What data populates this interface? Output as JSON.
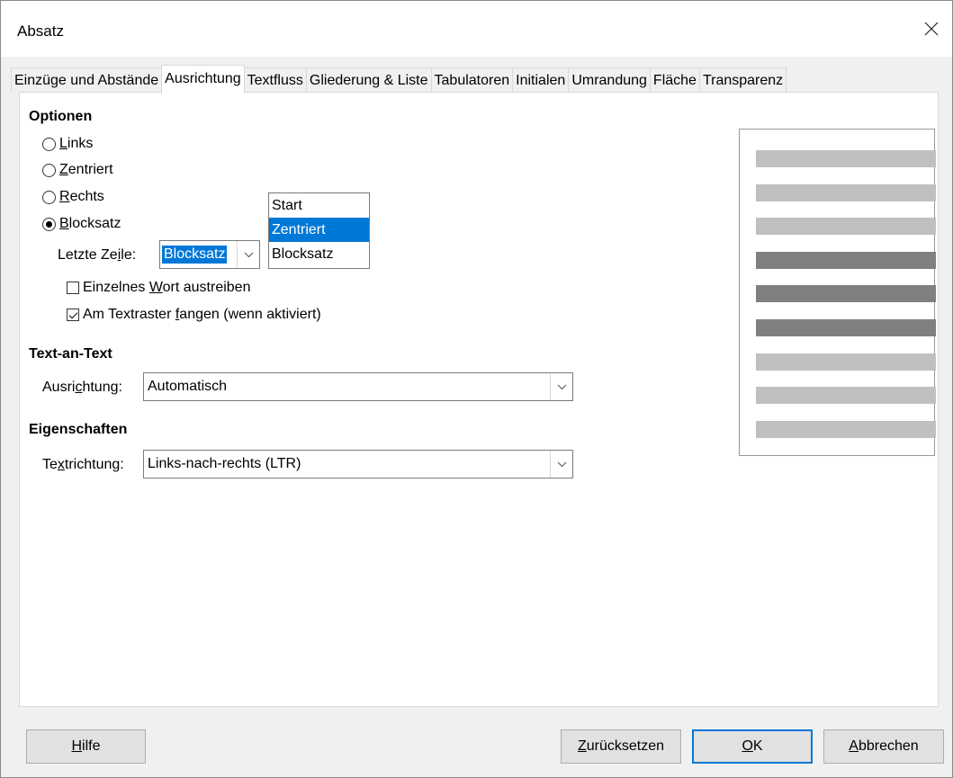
{
  "window": {
    "title": "Absatz"
  },
  "tabs": [
    {
      "label": "Einzüge und Abstände",
      "active": false
    },
    {
      "label": "Ausrichtung",
      "active": true
    },
    {
      "label": "Textfluss",
      "active": false
    },
    {
      "label": "Gliederung & Liste",
      "active": false
    },
    {
      "label": "Tabulatoren",
      "active": false
    },
    {
      "label": "Initialen",
      "active": false
    },
    {
      "label": "Umrandung",
      "active": false
    },
    {
      "label": "Fläche",
      "active": false
    },
    {
      "label": "Transparenz",
      "active": false
    }
  ],
  "options": {
    "heading": "Optionen",
    "radios": [
      {
        "accel": "L",
        "rest": "inks",
        "checked": false
      },
      {
        "accel": "Z",
        "rest": "entriert",
        "checked": false
      },
      {
        "accel": "R",
        "rest": "echts",
        "checked": false
      },
      {
        "accel": "B",
        "rest": "locksatz",
        "checked": true
      }
    ],
    "last_line": {
      "label_pre": "Letzte Ze",
      "label_accel": "i",
      "label_post": "le:",
      "value": "Blocksatz",
      "dropdown_options": [
        "Start",
        "Zentriert",
        "Blocksatz"
      ],
      "highlighted": "Zentriert"
    },
    "expand_word": {
      "pre": "Einzelnes ",
      "accel": "W",
      "post": "ort austreiben",
      "checked": false
    },
    "snap_grid": {
      "pre": "Am Textraster ",
      "accel": "f",
      "post": "angen (wenn aktiviert)",
      "checked": true
    }
  },
  "text_to_text": {
    "heading": "Text-an-Text",
    "label_pre": "Ausri",
    "label_accel": "c",
    "label_post": "htung:",
    "value": "Automatisch"
  },
  "properties": {
    "heading": "Eigenschaften",
    "label_pre": "Te",
    "label_accel": "x",
    "label_post": "trichtung:",
    "value": "Links-nach-rechts (LTR)"
  },
  "preview": {
    "colors": {
      "light": "#c0c0c0",
      "dark": "#808080"
    },
    "lines": [
      "light",
      "light",
      "light",
      "dark",
      "dark",
      "dark",
      "light",
      "light",
      "light"
    ]
  },
  "buttons": {
    "help": {
      "accel": "H",
      "rest": "ilfe"
    },
    "reset": {
      "accel": "Z",
      "rest": "urücksetzen"
    },
    "ok": {
      "accel": "O",
      "rest": "K"
    },
    "cancel": {
      "accel": "A",
      "rest": "bbrechen"
    }
  },
  "colors": {
    "accent": "#0078d7"
  }
}
